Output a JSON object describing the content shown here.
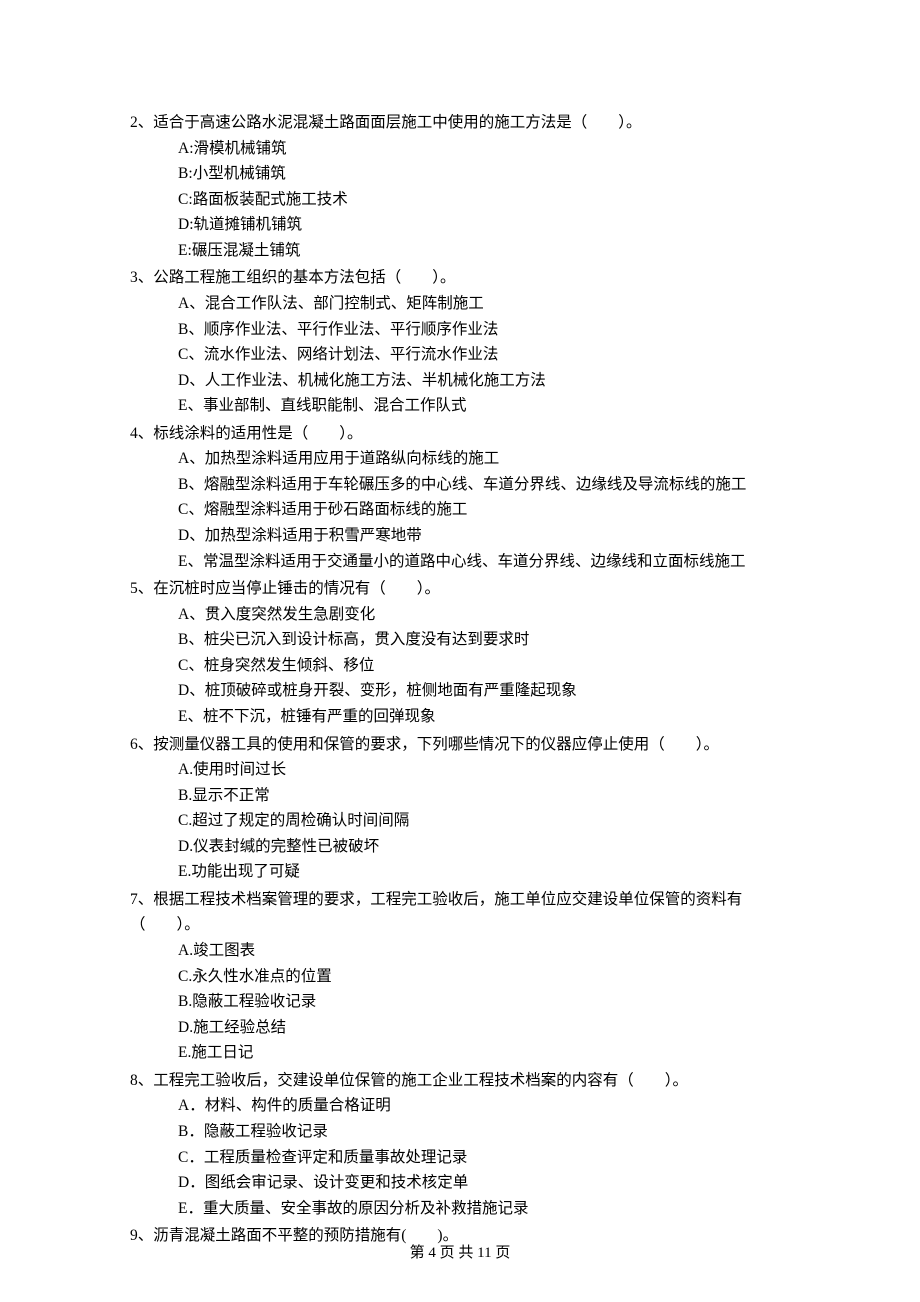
{
  "questions": [
    {
      "stem": "2、适合于高速公路水泥混凝土路面面层施工中使用的施工方法是（　　）。",
      "options": [
        "A:滑模机械铺筑",
        "B:小型机械铺筑",
        "C:路面板装配式施工技术",
        "D:轨道摊铺机铺筑",
        "E:碾压混凝土铺筑"
      ]
    },
    {
      "stem": "3、公路工程施工组织的基本方法包括（　　）。",
      "options": [
        "A、混合工作队法、部门控制式、矩阵制施工",
        "B、顺序作业法、平行作业法、平行顺序作业法",
        "C、流水作业法、网络计划法、平行流水作业法",
        "D、人工作业法、机械化施工方法、半机械化施工方法",
        "E、事业部制、直线职能制、混合工作队式"
      ]
    },
    {
      "stem": "4、标线涂料的适用性是（　　）。",
      "options": [
        "A、加热型涂料适用应用于道路纵向标线的施工",
        "B、熔融型涂料适用于车轮碾压多的中心线、车道分界线、边缘线及导流标线的施工",
        "C、熔融型涂料适用于砂石路面标线的施工",
        "D、加热型涂料适用于积雪严寒地带",
        "E、常温型涂料适用于交通量小的道路中心线、车道分界线、边缘线和立面标线施工"
      ]
    },
    {
      "stem": "5、在沉桩时应当停止锤击的情况有（　　）。",
      "options": [
        "A、贯入度突然发生急剧变化",
        "B、桩尖已沉入到设计标高，贯入度没有达到要求时",
        "C、桩身突然发生倾斜、移位",
        "D、桩顶破碎或桩身开裂、变形，桩侧地面有严重隆起现象",
        "E、桩不下沉，桩锤有严重的回弹现象"
      ]
    },
    {
      "stem": "6、按测量仪器工具的使用和保管的要求，下列哪些情况下的仪器应停止使用（　　）。",
      "options": [
        "A.使用时间过长",
        "B.显示不正常",
        "C.超过了规定的周检确认时间间隔",
        "D.仪表封缄的完整性已被破坏",
        "E.功能出现了可疑"
      ]
    },
    {
      "stem": "7、根据工程技术档案管理的要求，工程完工验收后，施工单位应交建设单位保管的资料有（　　）。",
      "options": [
        "A.竣工图表",
        "C.永久性水准点的位置",
        "B.隐蔽工程验收记录",
        "D.施工经验总结",
        "E.施工日记"
      ]
    },
    {
      "stem": "8、工程完工验收后，交建设单位保管的施工企业工程技术档案的内容有（　　）。",
      "options": [
        "A．材料、构件的质量合格证明",
        "B．隐蔽工程验收记录",
        "C．工程质量检查评定和质量事故处理记录",
        "D．图纸会审记录、设计变更和技术核定单",
        "E．重大质量、安全事故的原因分析及补救措施记录"
      ]
    },
    {
      "stem": "9、沥青混凝土路面不平整的预防措施有(　　)。",
      "options": []
    }
  ],
  "footer": "第 4 页 共 11 页"
}
